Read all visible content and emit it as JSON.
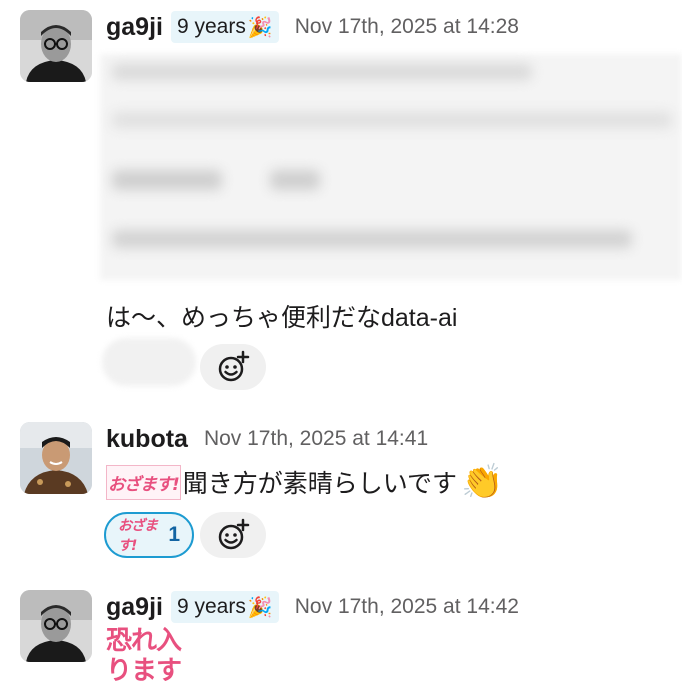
{
  "messages": [
    {
      "username": "ga9ji",
      "badge": "9 years",
      "badge_icon": "party-popper-icon",
      "timestamp": "Nov 17th, 2025 at 14:28",
      "text": "は〜、めっちゃ便利だなdata-ai"
    },
    {
      "username": "kubota",
      "timestamp": "Nov 17th, 2025 at 14:41",
      "text": "聞き方が素晴らしいです",
      "inline_stamp": "おざます!",
      "reaction_stamp": "おざます!",
      "reaction_count": "1"
    },
    {
      "username": "ga9ji",
      "badge": "9 years",
      "badge_icon": "party-popper-icon",
      "timestamp": "Nov 17th, 2025 at 14:42",
      "stamp_line1": "恐れ入",
      "stamp_line2": "ります"
    }
  ],
  "colors": {
    "badge_bg": "#e8f5fa",
    "reaction_border": "#1d9bd1",
    "reaction_count": "#1264a3",
    "stamp_pink": "#e8507f",
    "timestamp": "#616061"
  }
}
